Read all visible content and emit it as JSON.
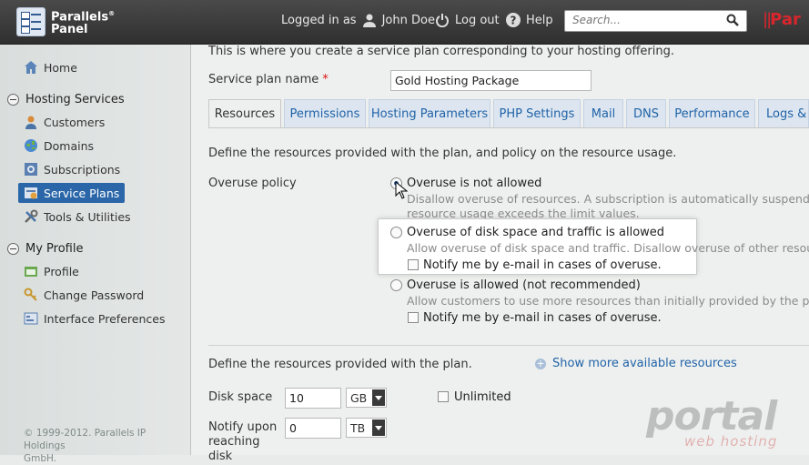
{
  "header": {
    "logo_line1": "Parallels",
    "logo_line2": "Panel",
    "logo_reg": "®",
    "logged_in_prefix": "Logged in as",
    "user_name": "John Doe",
    "logout_label": "Log out",
    "help_label": "Help",
    "search_placeholder": "Search...",
    "brand_right": "Par"
  },
  "sidebar": {
    "home": "Home",
    "hosting_services": "Hosting Services",
    "customers": "Customers",
    "domains": "Domains",
    "subscriptions": "Subscriptions",
    "service_plans": "Service Plans",
    "tools": "Tools & Utilities",
    "my_profile": "My Profile",
    "profile": "Profile",
    "change_password": "Change Password",
    "interface_prefs": "Interface Preferences",
    "copyright_line1": "© 1999-2012. Parallels IP Holdings",
    "copyright_line2": "GmbH."
  },
  "main": {
    "intro": "This is where you create a service plan corresponding to your hosting offering.",
    "plan_name_label": "Service plan name",
    "required_mark": "*",
    "plan_name_value": "Gold Hosting Package",
    "tabs": [
      "Resources",
      "Permissions",
      "Hosting Parameters",
      "PHP Settings",
      "Mail",
      "DNS",
      "Performance",
      "Logs & S"
    ],
    "define_text": "Define the resources provided with the plan, and policy on the resource usage.",
    "overuse_label": "Overuse policy",
    "options": [
      {
        "title": "Overuse is not allowed",
        "desc1": "Disallow overuse of resources. A subscription is automatically suspended if",
        "desc2": "resource usage exceeds the limit values."
      },
      {
        "title": "Overuse of disk space and traffic is allowed",
        "desc1": "Allow overuse of disk space and traffic. Disallow overuse of other resources",
        "notify": "Notify me by e-mail in cases of overuse."
      },
      {
        "title": "Overuse is allowed (not recommended)",
        "desc1": "Allow customers to use more resources than initially provided by the plan.",
        "notify": "Notify me by e-mail in cases of overuse."
      }
    ],
    "define_short": "Define the resources provided with the plan.",
    "show_more": "Show more available resources",
    "disk_label": "Disk space",
    "disk_value": "10",
    "disk_unit": "GB",
    "unlimited": "Unlimited",
    "notify_label_1": "Notify upon",
    "notify_label_2": "reaching",
    "notify_label_3": "disk",
    "notify_value": "0",
    "notify_unit": "TB"
  },
  "watermark": {
    "main": "portal",
    "sub": "web hosting"
  },
  "colors": {
    "accent": "#2063a8",
    "active_nav": "#2a66a8",
    "header_bg": "#3a3a3a"
  }
}
